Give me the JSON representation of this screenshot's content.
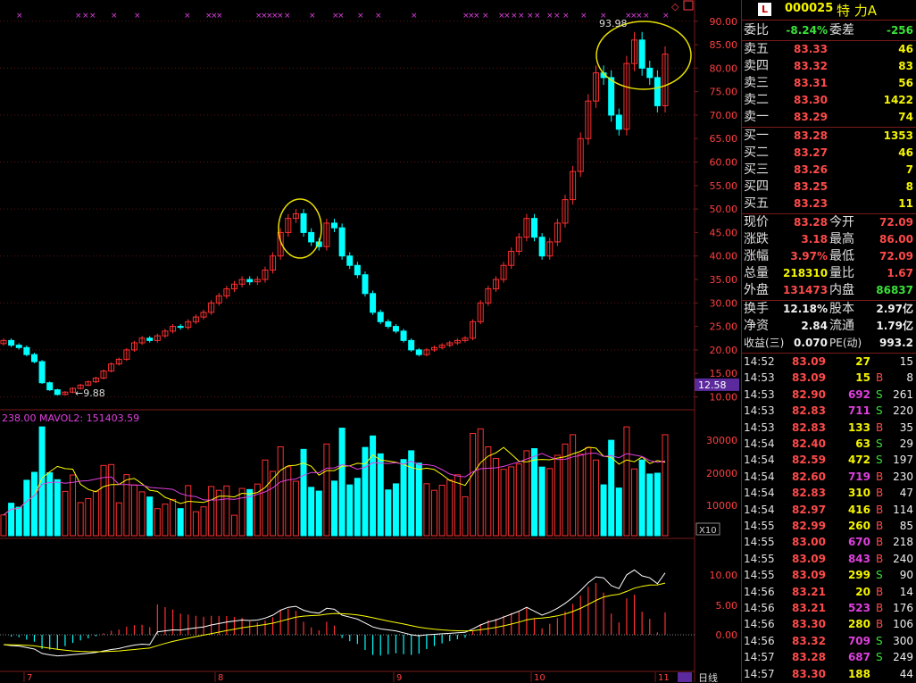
{
  "stock": {
    "code": "000025",
    "name": "特  力A",
    "logo": "L"
  },
  "order_book": {
    "weibi_label": "委比",
    "weibi_value": "-8.24%",
    "weicha_label": "委差",
    "weicha_value": "-256",
    "asks": [
      {
        "label": "卖五",
        "price": "83.33",
        "volume": "46"
      },
      {
        "label": "卖四",
        "price": "83.32",
        "volume": "83"
      },
      {
        "label": "卖三",
        "price": "83.31",
        "volume": "56"
      },
      {
        "label": "卖二",
        "price": "83.30",
        "volume": "1422"
      },
      {
        "label": "卖一",
        "price": "83.29",
        "volume": "74"
      }
    ],
    "bids": [
      {
        "label": "买一",
        "price": "83.28",
        "volume": "1353"
      },
      {
        "label": "买二",
        "price": "83.27",
        "volume": "46"
      },
      {
        "label": "买三",
        "price": "83.26",
        "volume": "7"
      },
      {
        "label": "买四",
        "price": "83.25",
        "volume": "8"
      },
      {
        "label": "买五",
        "price": "83.23",
        "volume": "11"
      }
    ]
  },
  "quote": {
    "xianjia_label": "现价",
    "xianjia": "83.28",
    "jinkai_label": "今开",
    "jinkai": "72.09",
    "zhangdie_label": "涨跌",
    "zhangdie": "3.18",
    "zuigao_label": "最高",
    "zuigao": "86.00",
    "zhangfu_label": "涨幅",
    "zhangfu": "3.97%",
    "zuidi_label": "最低",
    "zuidi": "72.09",
    "zongliang_label": "总量",
    "zongliang": "218310",
    "liangbi_label": "量比",
    "liangbi": "1.67",
    "waipan_label": "外盘",
    "waipan": "131473",
    "neipan_label": "内盘",
    "neipan": "86837",
    "huanshou_label": "换手",
    "huanshou": "12.18%",
    "guben_label": "股本",
    "guben": "2.97亿",
    "jingzi_label": "净资",
    "jingzi": "2.84",
    "liutong_label": "流通",
    "liutong": "1.79亿",
    "shouyi_label": "收益(三)",
    "shouyi": "0.070",
    "pe_label": "PE(动)",
    "pe": "993.2"
  },
  "ticks": [
    {
      "time": "14:52",
      "price": "83.09",
      "vol": "27",
      "bs": "",
      "n": "15",
      "c": "yel"
    },
    {
      "time": "14:53",
      "price": "83.09",
      "vol": "15",
      "bs": "B",
      "n": "8",
      "c": "yel"
    },
    {
      "time": "14:53",
      "price": "82.90",
      "vol": "692",
      "bs": "S",
      "n": "261",
      "c": "mag"
    },
    {
      "time": "14:53",
      "price": "82.83",
      "vol": "711",
      "bs": "S",
      "n": "220",
      "c": "mag"
    },
    {
      "time": "14:53",
      "price": "82.83",
      "vol": "133",
      "bs": "B",
      "n": "35",
      "c": "yel"
    },
    {
      "time": "14:54",
      "price": "82.40",
      "vol": "63",
      "bs": "S",
      "n": "29",
      "c": "yel"
    },
    {
      "time": "14:54",
      "price": "82.59",
      "vol": "472",
      "bs": "S",
      "n": "197",
      "c": "yel"
    },
    {
      "time": "14:54",
      "price": "82.60",
      "vol": "719",
      "bs": "B",
      "n": "230",
      "c": "mag"
    },
    {
      "time": "14:54",
      "price": "82.83",
      "vol": "310",
      "bs": "B",
      "n": "47",
      "c": "yel"
    },
    {
      "time": "14:54",
      "price": "82.97",
      "vol": "416",
      "bs": "B",
      "n": "114",
      "c": "yel"
    },
    {
      "time": "14:55",
      "price": "82.99",
      "vol": "260",
      "bs": "B",
      "n": "85",
      "c": "yel"
    },
    {
      "time": "14:55",
      "price": "83.00",
      "vol": "670",
      "bs": "B",
      "n": "218",
      "c": "mag"
    },
    {
      "time": "14:55",
      "price": "83.09",
      "vol": "843",
      "bs": "B",
      "n": "240",
      "c": "mag"
    },
    {
      "time": "14:55",
      "price": "83.09",
      "vol": "299",
      "bs": "S",
      "n": "90",
      "c": "yel"
    },
    {
      "time": "14:56",
      "price": "83.21",
      "vol": "20",
      "bs": "B",
      "n": "14",
      "c": "yel"
    },
    {
      "time": "14:56",
      "price": "83.21",
      "vol": "523",
      "bs": "B",
      "n": "176",
      "c": "mag"
    },
    {
      "time": "14:56",
      "price": "83.30",
      "vol": "280",
      "bs": "B",
      "n": "106",
      "c": "yel"
    },
    {
      "time": "14:56",
      "price": "83.32",
      "vol": "709",
      "bs": "S",
      "n": "300",
      "c": "mag"
    },
    {
      "time": "14:57",
      "price": "83.28",
      "vol": "687",
      "bs": "S",
      "n": "249",
      "c": "mag"
    },
    {
      "time": "14:57",
      "price": "83.30",
      "vol": "188",
      "bs": "",
      "n": "44",
      "c": "yel"
    }
  ],
  "chart": {
    "price_axis": [
      "90.00",
      "85.00",
      "80.00",
      "75.00",
      "70.00",
      "65.00",
      "60.00",
      "55.00",
      "50.00",
      "45.00",
      "40.00",
      "35.00",
      "30.00",
      "25.00",
      "20.00",
      "15.00",
      "10.00"
    ],
    "vol_axis": [
      "30000",
      "20000",
      "10000"
    ],
    "vol_unit": "X10",
    "macd_axis": [
      "10.00",
      "5.00",
      "0.00"
    ],
    "current_price_tag": "12.58",
    "high_label": "93.98",
    "low_label": "9.88",
    "vol_header": "238.00  MAVOL2: 151403.59",
    "month_labels": [
      "7",
      "8",
      "9",
      "10",
      "11"
    ],
    "period_label": "日线"
  },
  "colors": {
    "up": "#ff3030",
    "down": "#00ffff",
    "ma1": "#ffffff",
    "ma2": "#ffff00",
    "mavol2": "#e040e0",
    "grid": "#7a1a1a"
  }
}
